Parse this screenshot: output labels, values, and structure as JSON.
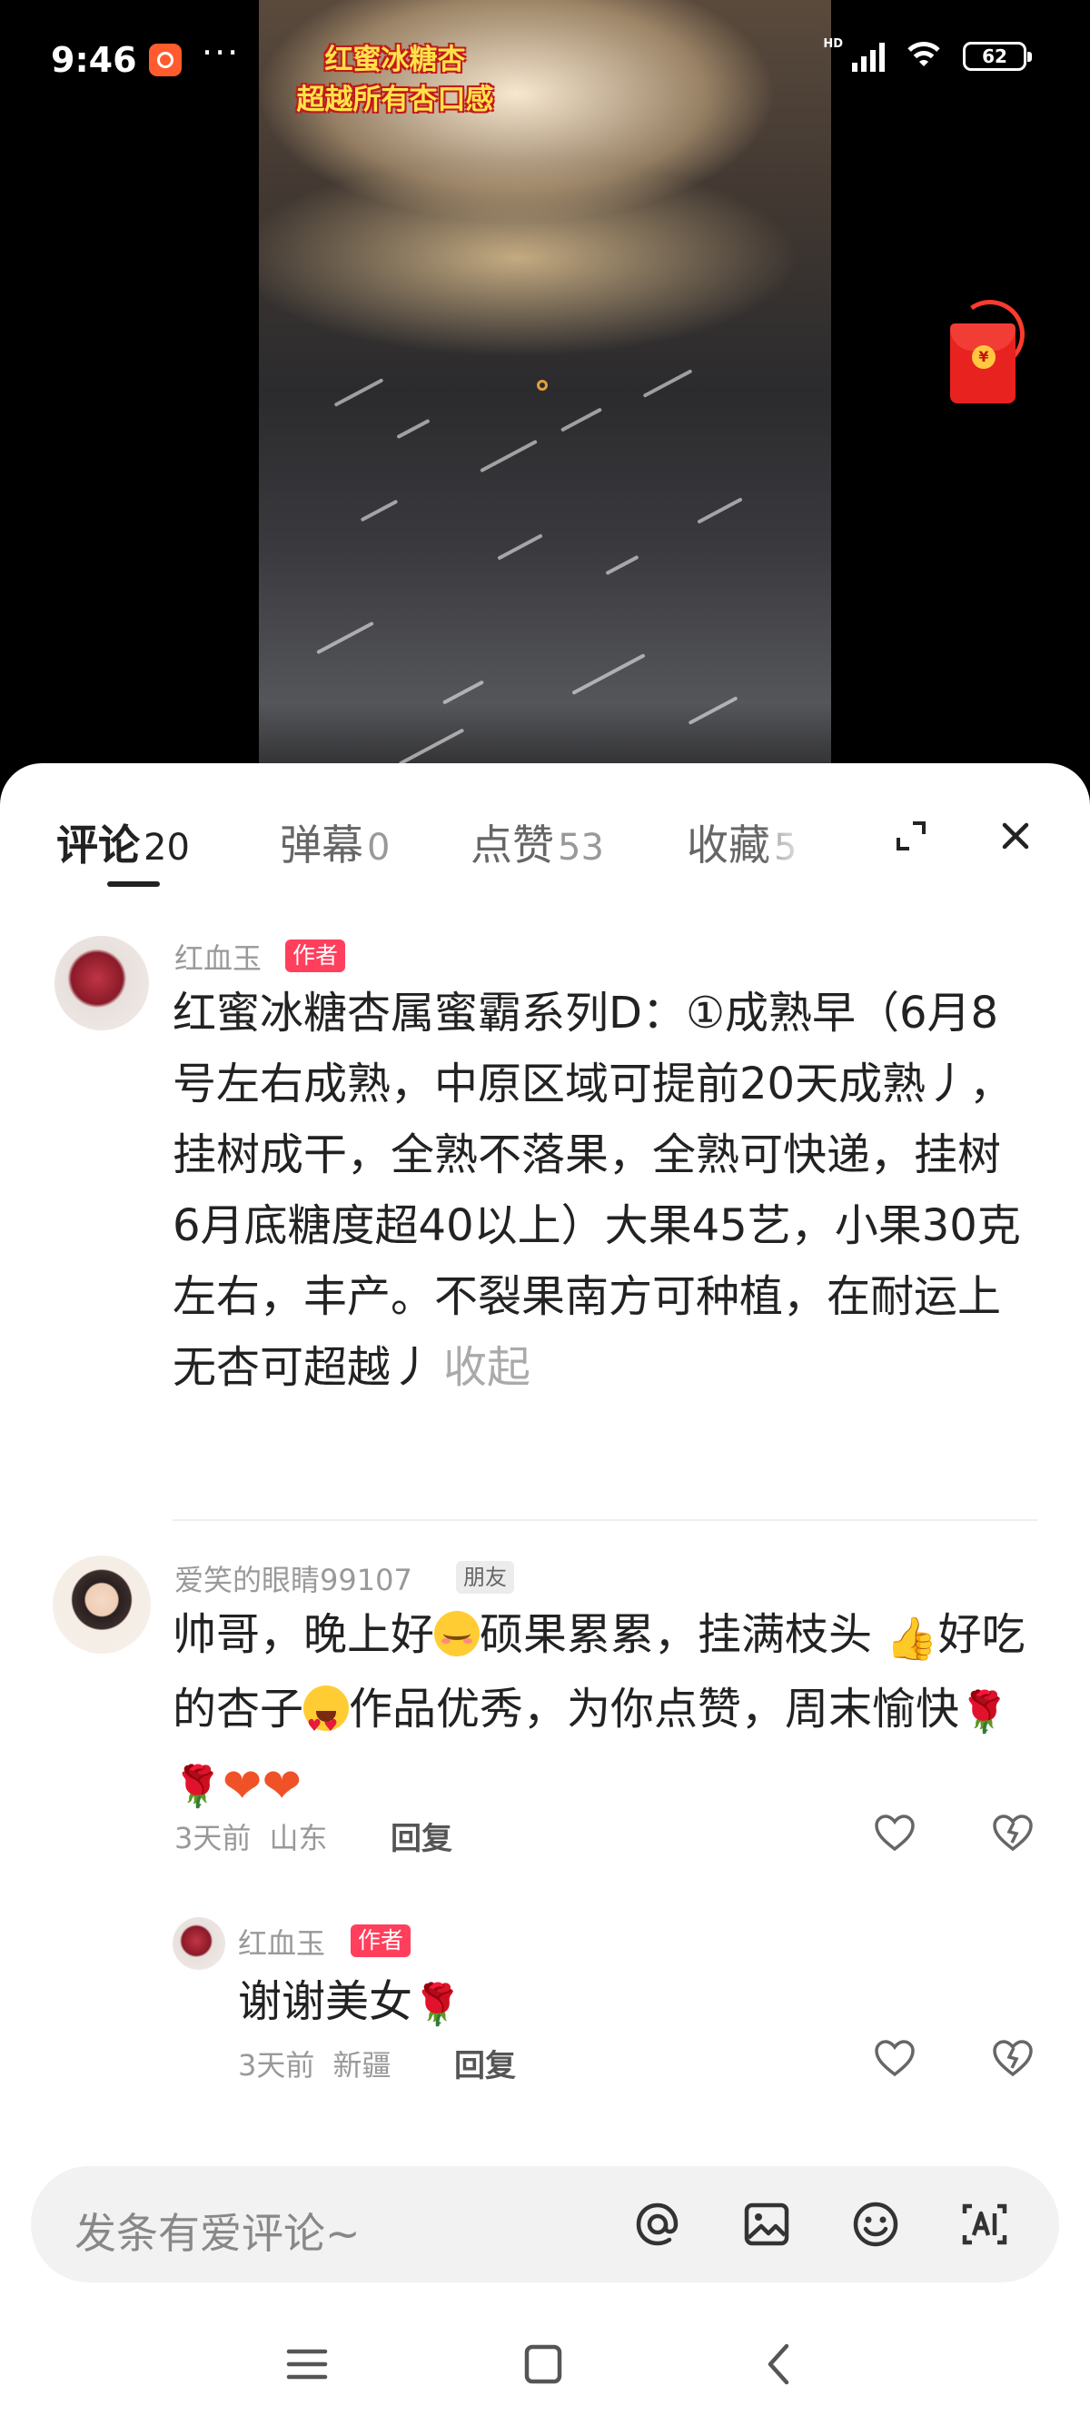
{
  "status_bar": {
    "time": "9:46",
    "more": "···",
    "hd_label": "HD",
    "battery": "62"
  },
  "video": {
    "overlay_title_line1": "红蜜冰糖杏",
    "overlay_title_line2": "超越所有杏口感"
  },
  "tabs": [
    {
      "label": "评论",
      "count": "20",
      "active": true
    },
    {
      "label": "弹幕",
      "count": "0",
      "active": false
    },
    {
      "label": "点赞",
      "count": "53",
      "active": false
    },
    {
      "label": "收藏",
      "count": "5",
      "active": false
    }
  ],
  "comments": [
    {
      "username": "红血玉",
      "badge": "作者",
      "text": "红蜜冰糖杏属蜜霸系列D：①成熟早（6月8号左右成熟，中原区域可提前20天成熟丿，挂树成干，全熟不落果，全熟可快递，挂树6月底糖度超40以上）大果45艺，小果30克左右，丰产。不裂果南方可种植，在耐运上无杏可超越丿",
      "collapse_label": "收起"
    },
    {
      "username": "爱笑的眼睛99107",
      "badge": "朋友",
      "text_part1": "帅哥，晚上好",
      "text_part2": "硕果累累，挂满枝头",
      "text_part3": "好吃的杏子",
      "text_part4": "作品优秀，为你点赞，周末愉快",
      "time": "3天前",
      "location": "山东",
      "reply_label": "回复",
      "reply": {
        "username": "红血玉",
        "badge": "作者",
        "text": "谢谢美女",
        "time": "3天前",
        "location": "新疆",
        "reply_label": "回复"
      }
    }
  ],
  "input": {
    "placeholder": "发条有爱评论~"
  },
  "icons": {
    "at": "at-icon",
    "image": "image-icon",
    "emoji": "emoji-icon",
    "ai": "ai-icon",
    "expand": "expand-icon",
    "close": "close-icon"
  },
  "colors": {
    "author_badge": "#ff3f5c",
    "video_title": "#ffe24a",
    "red_packet": "#e8231f"
  }
}
